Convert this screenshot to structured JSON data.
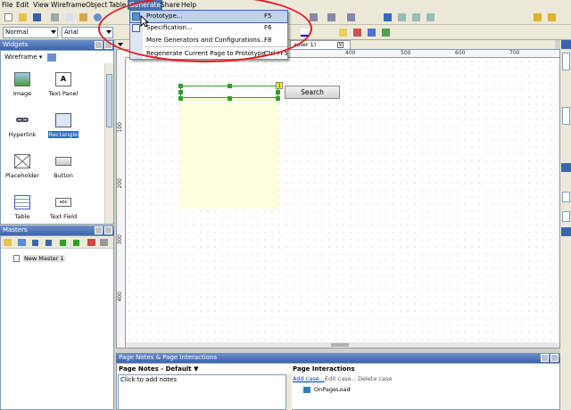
{
  "menu": [
    "File",
    "Edit",
    "View",
    "Wireframe",
    "Object",
    "Table",
    "Generate",
    "Share",
    "Help"
  ],
  "toolbar": {
    "style_value": "Normal",
    "font_value": "Arial"
  },
  "tabs": {
    "page_tab": "aster 1)"
  },
  "widgets": {
    "title": "Widgets",
    "library": "Wireframe",
    "items": [
      "Image",
      "Text Panel",
      "Hyperlink",
      "Rectangle",
      "Placeholder",
      "Button",
      "Table",
      "Text Field"
    ]
  },
  "masters": {
    "title": "Masters",
    "items": [
      "New Master 1"
    ]
  },
  "generate_menu": {
    "items": [
      {
        "label": "Prototype...",
        "shortcut": "F5"
      },
      {
        "label": "Specification...",
        "shortcut": "F6"
      },
      {
        "label": "More Generators and Configurations...",
        "shortcut": "F8"
      },
      {
        "label": "Regenerate Current Page to Prototype",
        "shortcut": "Ctrl+F5"
      }
    ]
  },
  "ruler": {
    "top": [
      "400",
      "500",
      "600",
      "700"
    ],
    "left": [
      "100",
      "200",
      "300",
      "400"
    ]
  },
  "canvas": {
    "search_button": "Search",
    "badge": "1"
  },
  "bottom": {
    "title": "Page Notes & Page Interactions",
    "notes_header": "Page Notes - Default",
    "notes_placeholder": "Click to add notes",
    "interactions_header": "Page Interactions",
    "add_case": "Add case...",
    "edit_case": "Edit case...",
    "delete_case": "Delete case",
    "event": "OnPageLoad"
  },
  "colors": {
    "accent_blue": "#316ac5",
    "annotation_red": "#e31b23",
    "panel_yellow": "#ffffdd"
  }
}
